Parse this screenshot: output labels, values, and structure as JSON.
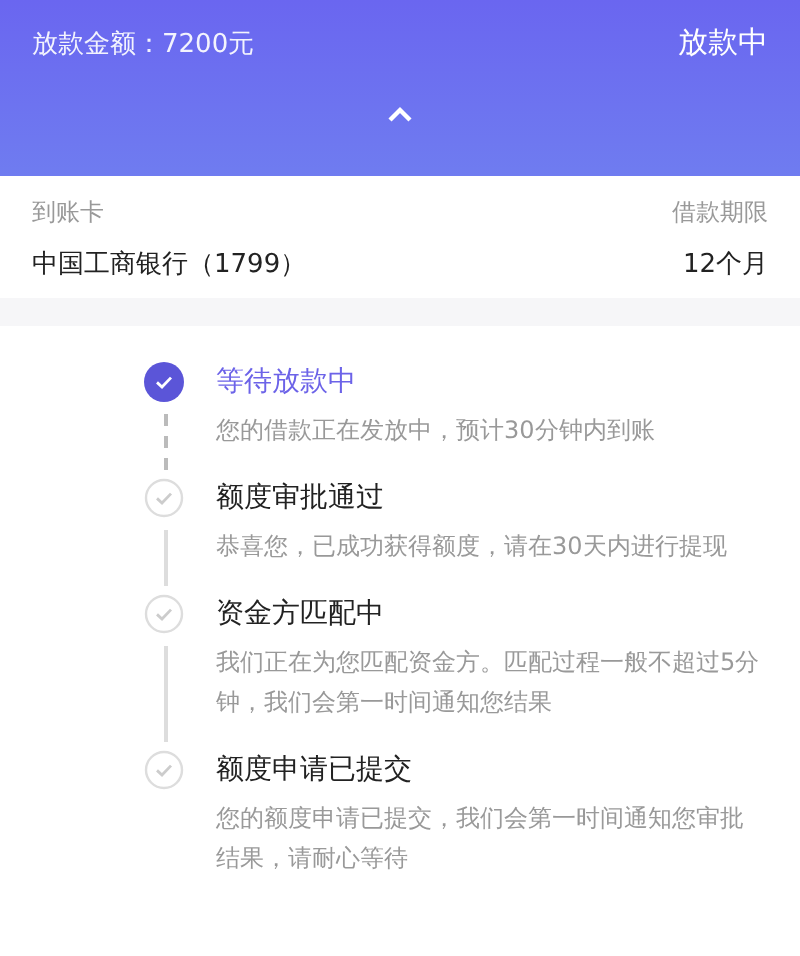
{
  "header": {
    "amount": "放款金额：7200元",
    "status": "放款中"
  },
  "info": {
    "card_label": "到账卡",
    "term_label": "借款期限",
    "card_value": "中国工商银行（1799）",
    "term_value": "12个月"
  },
  "steps": [
    {
      "title": "等待放款中",
      "description": "您的借款正在发放中，预计30分钟内到账",
      "active": true
    },
    {
      "title": "额度审批通过",
      "description": "恭喜您，已成功获得额度，请在30天内进行提现",
      "active": false
    },
    {
      "title": "资金方匹配中",
      "description": "我们正在为您匹配资金方。匹配过程一般不超过5分钟，我们会第一时间通知您结果",
      "active": false
    },
    {
      "title": "额度申请已提交",
      "description": "您的额度申请已提交，我们会第一时间通知您审批结果，请耐心等待",
      "active": false
    }
  ]
}
